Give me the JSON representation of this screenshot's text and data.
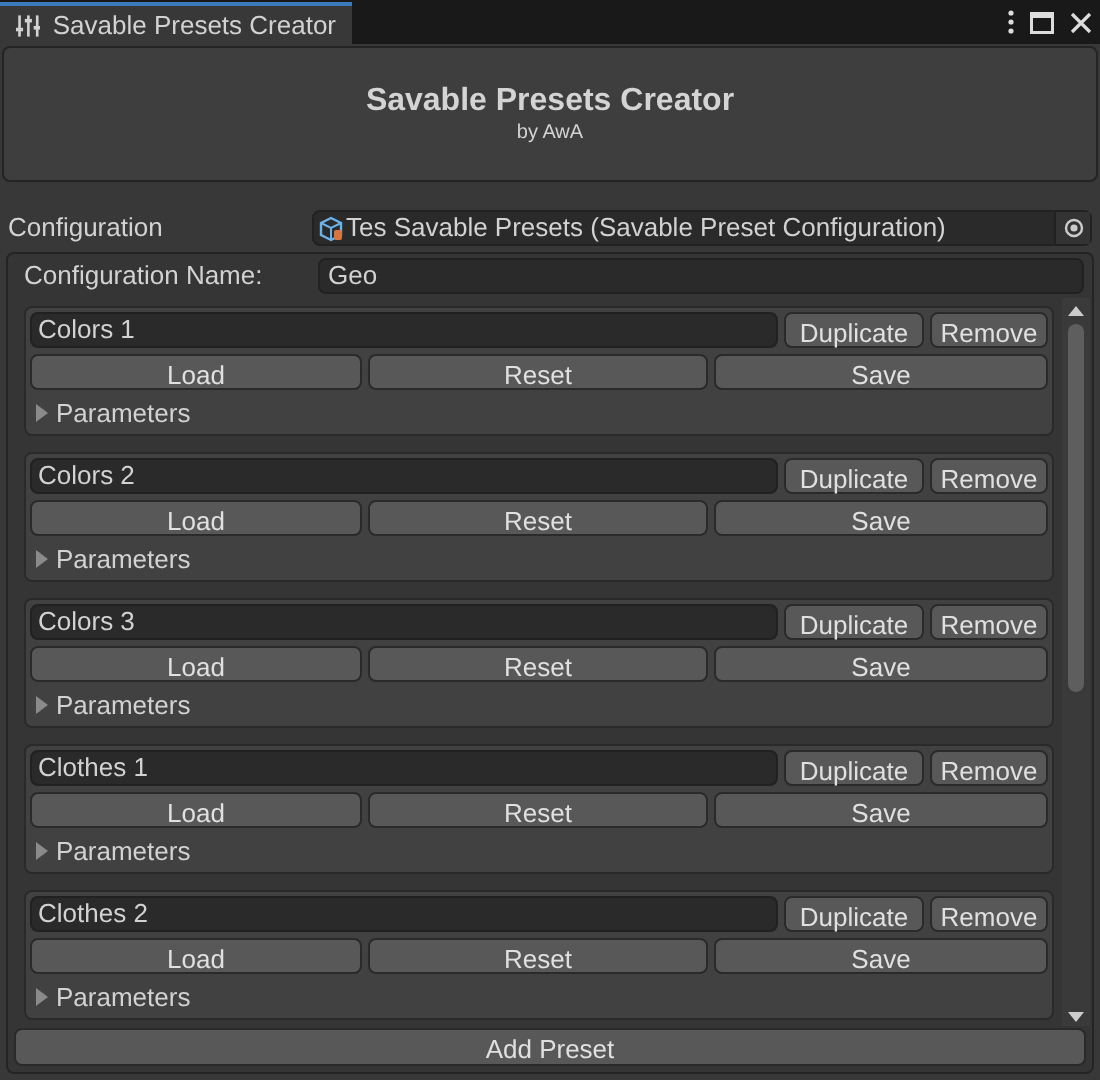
{
  "window": {
    "tab_title": "Savable Presets Creator"
  },
  "header": {
    "title": "Savable Presets Creator",
    "subtitle": "by AwA"
  },
  "configuration": {
    "label": "Configuration",
    "value": "Tes Savable Presets (Savable Preset Configuration)"
  },
  "configuration_name": {
    "label": "Configuration Name:",
    "value": "Geo"
  },
  "presets": [
    {
      "name": "Colors 1",
      "duplicate": "Duplicate",
      "remove": "Remove",
      "load": "Load",
      "reset": "Reset",
      "save": "Save",
      "parameters": "Parameters",
      "expanded": false
    },
    {
      "name": "Colors 2",
      "duplicate": "Duplicate",
      "remove": "Remove",
      "load": "Load",
      "reset": "Reset",
      "save": "Save",
      "parameters": "Parameters",
      "expanded": false
    },
    {
      "name": "Colors 3",
      "duplicate": "Duplicate",
      "remove": "Remove",
      "load": "Load",
      "reset": "Reset",
      "save": "Save",
      "parameters": "Parameters",
      "expanded": false
    },
    {
      "name": "Clothes 1",
      "duplicate": "Duplicate",
      "remove": "Remove",
      "load": "Load",
      "reset": "Reset",
      "save": "Save",
      "parameters": "Parameters",
      "expanded": false
    },
    {
      "name": "Clothes 2",
      "duplicate": "Duplicate",
      "remove": "Remove",
      "load": "Load",
      "reset": "Reset",
      "save": "Save",
      "parameters": "Parameters",
      "expanded": false
    }
  ],
  "add_button": "Add Preset"
}
